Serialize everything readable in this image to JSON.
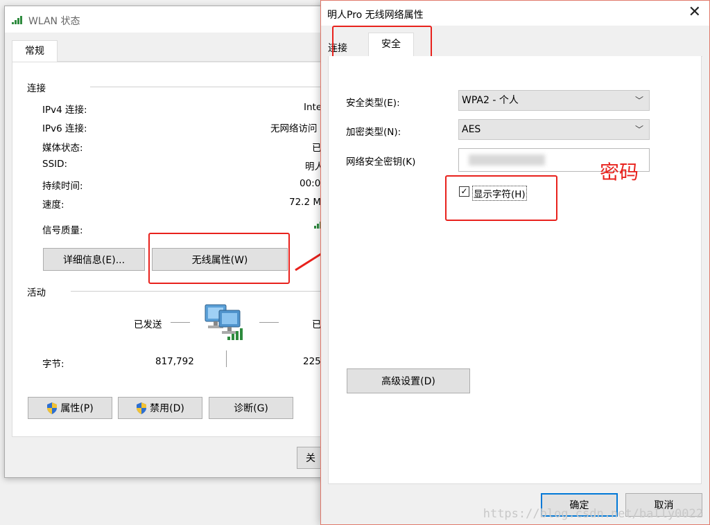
{
  "wlan_status": {
    "title": "WLAN 状态",
    "tab": "常规",
    "connection_group": "连接",
    "rows": [
      {
        "label": "IPv4 连接:",
        "value": "Inte"
      },
      {
        "label": "IPv6 连接:",
        "value": "无网络访问"
      },
      {
        "label": "媒体状态:",
        "value": "已"
      },
      {
        "label": "SSID:",
        "value": "明人"
      },
      {
        "label": "持续时间:",
        "value": "00:0"
      },
      {
        "label": "速度:",
        "value": "72.2 M"
      }
    ],
    "signal_label": "信号质量:",
    "details_button": "详细信息(E)...",
    "wireless_props_button": "无线属性(W)",
    "activity_group": "活动",
    "sent_label": "已发送",
    "received_label_partial": "已",
    "bytes_label": "字节:",
    "bytes_sent": "817,792",
    "bytes_received_partial": "225",
    "properties_button": "属性(P)",
    "disable_button": "禁用(D)",
    "diagnose_button": "诊断(G)",
    "close_button_partial": "关"
  },
  "wireless_props": {
    "title": "明人Pro 无线网络属性",
    "tab_connection": "连接",
    "tab_security": "安全",
    "security_type_label": "安全类型(E):",
    "security_type_value": "WPA2 - 个人",
    "encryption_type_label": "加密类型(N):",
    "encryption_type_value": "AES",
    "network_key_label": "网络安全密钥(K)",
    "show_chars_label": "显示字符(H)",
    "show_chars_checked": "✓",
    "advanced_button": "高级设置(D)",
    "ok_button": "确定",
    "cancel_button": "取消"
  },
  "annotation": {
    "password_note": "密码",
    "color": "#e8211c"
  },
  "watermark": "https://blog.csdn.net/bally0022"
}
